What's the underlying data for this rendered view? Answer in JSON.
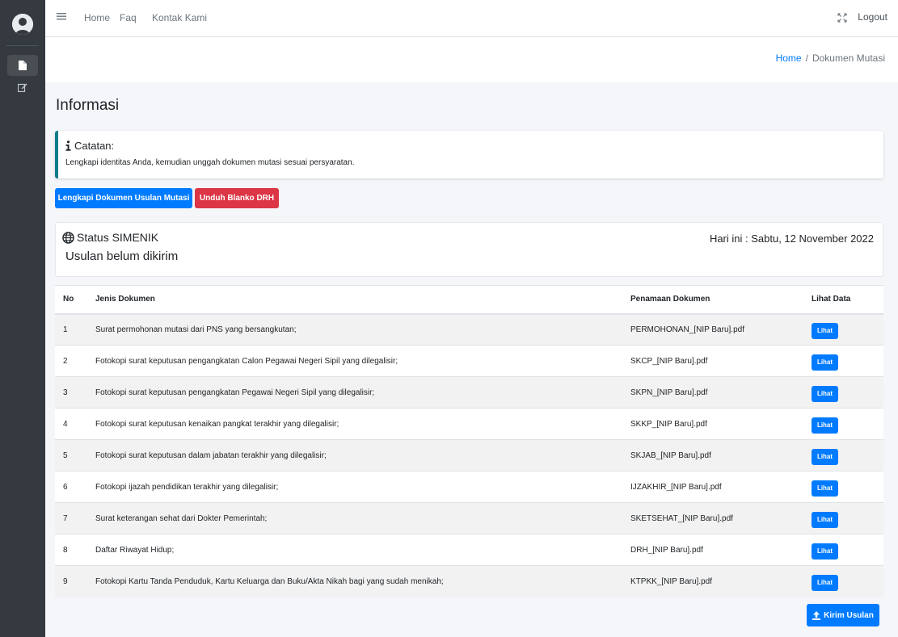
{
  "nav": {
    "home": "Home",
    "faq": "Faq",
    "contact": "Kontak Kami",
    "logout": "Logout"
  },
  "breadcrumb": {
    "home": "Home",
    "separator": "/",
    "current": "Dokumen Mutasi"
  },
  "page_title": "Informasi",
  "callout": {
    "title": "Catatan:",
    "text": "Lengkapi identitas Anda, kemudian unggah dokumen mutasi sesuai persyaratan."
  },
  "buttons": {
    "lengkapi": "Lengkapi Dokumen Usulan Mutasi",
    "unduh": "Unduh Blanko DRH",
    "kirim": "Kirim Usulan"
  },
  "status": {
    "title": "Status SIMENIK",
    "subtitle": "Usulan belum dikirim",
    "today": "Hari ini : Sabtu, 12 November 2022"
  },
  "table": {
    "headers": [
      "No",
      "Jenis Dokumen",
      "Penamaan Dokumen",
      "Lihat Data"
    ],
    "view_label": "Lihat",
    "rows": [
      {
        "no": "1",
        "jenis": "Surat permohonan mutasi dari PNS yang bersangkutan;",
        "nama": "PERMOHONAN_[NIP Baru].pdf"
      },
      {
        "no": "2",
        "jenis": "Fotokopi surat keputusan pengangkatan Calon Pegawai Negeri Sipil yang dilegalisir;",
        "nama": "SKCP_[NIP Baru].pdf"
      },
      {
        "no": "3",
        "jenis": "Fotokopi surat keputusan pengangkatan Pegawai Negeri Sipil yang dilegalisir;",
        "nama": "SKPN_[NIP Baru].pdf"
      },
      {
        "no": "4",
        "jenis": "Fotokopi surat keputusan kenaikan pangkat terakhir yang dilegalisir;",
        "nama": "SKKP_[NIP Baru].pdf"
      },
      {
        "no": "5",
        "jenis": "Fotokopi surat keputusan dalam jabatan terakhir yang dilegalisir;",
        "nama": "SKJAB_[NIP Baru].pdf"
      },
      {
        "no": "6",
        "jenis": "Fotokopi ijazah pendidikan terakhir yang dilegalisir;",
        "nama": "IJZAKHIR_[NIP Baru].pdf"
      },
      {
        "no": "7",
        "jenis": "Surat keterangan sehat dari Dokter Pemerintah;",
        "nama": "SKETSEHAT_[NIP Baru].pdf"
      },
      {
        "no": "8",
        "jenis": "Daftar Riwayat Hidup;",
        "nama": "DRH_[NIP Baru].pdf"
      },
      {
        "no": "9",
        "jenis": "Fotokopi Kartu Tanda Penduduk, Kartu Keluarga dan Buku/Akta Nikah bagi yang sudah menikah;",
        "nama": "KTPKK_[NIP Baru].pdf"
      }
    ]
  },
  "icons": {
    "menu": "hamburger-icon",
    "fullscreen": "expand-icon",
    "info": "info-icon",
    "globe": "globe-icon",
    "upload": "upload-icon",
    "file": "file-icon",
    "edit": "edit-icon"
  },
  "colors": {
    "primary": "#007bff",
    "danger": "#dc3545",
    "sidebar": "#343a40",
    "callout_border": "#117a8b"
  }
}
